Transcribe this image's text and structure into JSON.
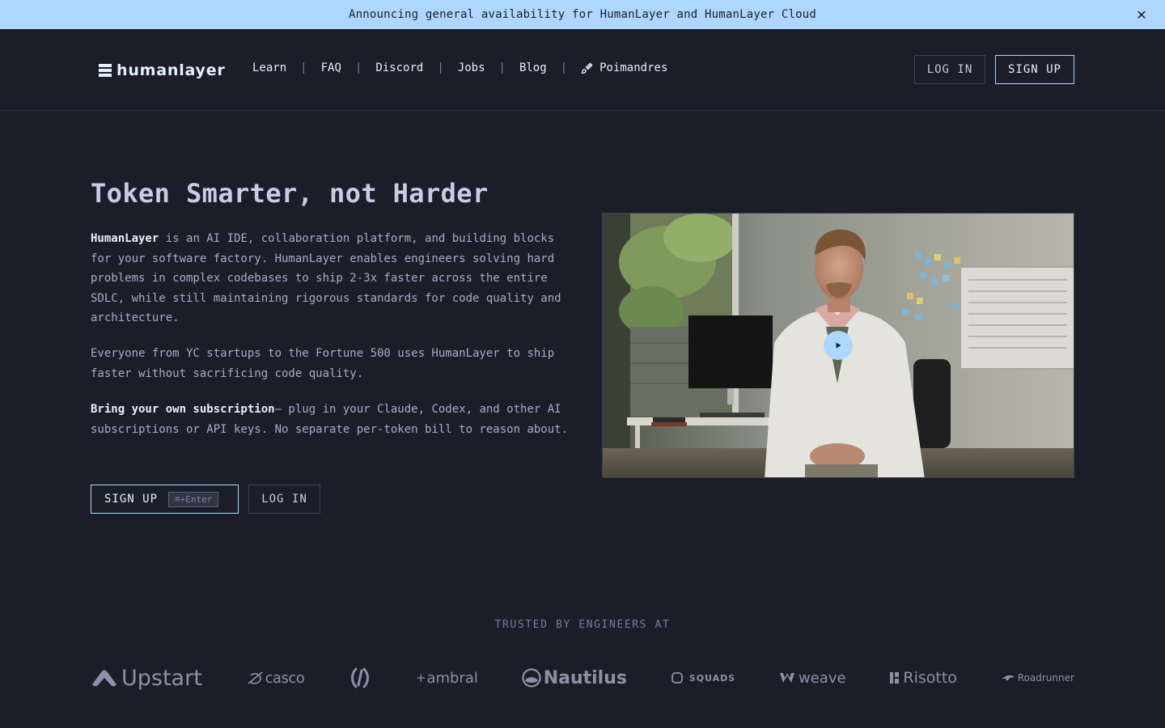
{
  "banner": {
    "text": "Announcing general availability for HumanLayer and HumanLayer Cloud",
    "close_icon": "close-icon"
  },
  "header": {
    "logo_text": "humanlayer",
    "nav": [
      "Learn",
      "FAQ",
      "Discord",
      "Jobs",
      "Blog"
    ],
    "theme_label": "Poimandres",
    "login_label": "LOG IN",
    "signup_label": "SIGN UP"
  },
  "hero": {
    "title": "Token Smarter, not Harder",
    "p1_bold": "HumanLayer",
    "p1_text": " is an AI IDE, collaboration platform, and building blocks for your software factory. HumanLayer enables engineers solving hard problems in complex codebases to ship 2-3x faster across the entire SDLC, while still maintaining rigorous standards for code quality and architecture.",
    "p2_text": "Everyone from YC startups to the Fortune 500 uses HumanLayer to ship faster without sacrificing code quality.",
    "p3_bold": "Bring your own subscription",
    "p3_text": "— plug in your Claude, Codex, and other AI subscriptions or API keys. No separate per-token bill to reason about.",
    "signup_label": "SIGN UP",
    "signup_shortcut": "⌘+Enter",
    "login_label": "LOG IN"
  },
  "video": {
    "play_icon": "play-icon"
  },
  "trusted": {
    "heading": "TRUSTED BY ENGINEERS AT",
    "logos": [
      "Upstart",
      "casco",
      "",
      "ambral",
      "Nautilus",
      "SQUADS",
      "weave",
      "Risotto",
      "Roadrunner"
    ]
  },
  "colors": {
    "background": "#1b1e28",
    "banner": "#add7ff",
    "accent": "#add7ff",
    "text": "#a6accd",
    "heading": "#c6cde8"
  }
}
